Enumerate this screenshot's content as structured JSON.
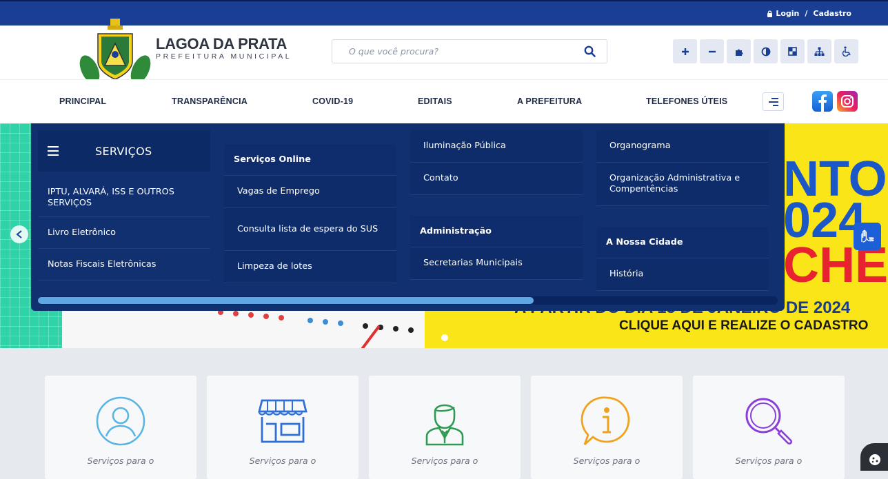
{
  "topbar": {
    "login": "Login",
    "sep": "/",
    "register": "Cadastro"
  },
  "brand": {
    "name": "LAGOA DA PRATA",
    "subtitle": "PREFEITURA MUNICIPAL"
  },
  "search": {
    "placeholder": "O que você procura?"
  },
  "accessibility": [
    "plus-icon",
    "minus-icon",
    "puzzle-icon",
    "contrast-icon",
    "invert-icon",
    "sitemap-icon",
    "wheelchair-icon"
  ],
  "nav": {
    "items": [
      "PRINCIPAL",
      "TRANSPARÊNCIA",
      "COVID-19",
      "EDITAIS",
      "A PREFEITURA",
      "TELEFONES ÚTEIS"
    ]
  },
  "mega": {
    "title": "SERVIÇOS",
    "col1": [
      "IPTU, ALVARÁ, ISS E OUTROS SERVIÇOS",
      "Livro Eletrônico",
      "Notas Fiscais Eletrônicas"
    ],
    "col2_head": "Serviços Online",
    "col2": [
      "Vagas de Emprego",
      "Consulta lista de espera do SUS",
      "Limpeza de lotes"
    ],
    "col3": [
      "Iluminação Pública",
      "Contato"
    ],
    "col3_head": "Administração",
    "col3b": [
      "Secretarias Municipais"
    ],
    "col4": [
      "Organograma",
      "Organização Administrativa e Compentências"
    ],
    "col4_head": "A Nossa Cidade",
    "col4b": [
      "História"
    ],
    "scroll_progress": 0.67
  },
  "banner": {
    "line1": "NTO",
    "line2": "024",
    "line3": "CHE",
    "footer1": "A PARTIR DO DIA 15 DE JANEIRO DE 2024",
    "footer2": "CLIQUE AQUI E REALIZE O CADASTRO"
  },
  "cards": [
    {
      "label": "Serviços para o",
      "icon": "user-icon",
      "color": "#5ab5e3"
    },
    {
      "label": "Serviços para o",
      "icon": "store-icon",
      "color": "#2f6fd6"
    },
    {
      "label": "Serviços para o",
      "icon": "employee-icon",
      "color": "#2f9a52"
    },
    {
      "label": "Serviços para o",
      "icon": "info-chat-icon",
      "color": "#f0a21c"
    },
    {
      "label": "Serviços para o",
      "icon": "search-icon",
      "color": "#8a3fd6"
    }
  ],
  "colors": {
    "primary": "#1a3e94",
    "mega": "#11306f",
    "accent": "#5fa6e4"
  }
}
